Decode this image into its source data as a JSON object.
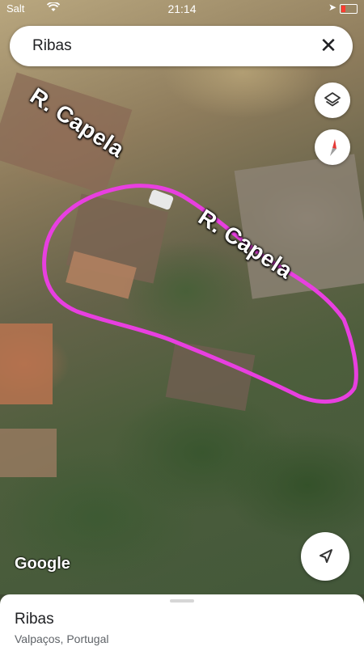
{
  "status_bar": {
    "carrier": "Salt",
    "time": "21:14"
  },
  "search": {
    "query": "Ribas"
  },
  "map": {
    "type": "satellite",
    "road_labels": [
      "R. Capela",
      "R. Capela"
    ],
    "attribution": "Google",
    "annotation_color": "#e83fe0"
  },
  "place": {
    "name": "Ribas",
    "subtitle": "Valpaços, Portugal"
  },
  "icons": {
    "close": "close-icon",
    "layers": "layers-icon",
    "compass": "compass-icon",
    "my_location": "navigation-arrow-icon"
  }
}
